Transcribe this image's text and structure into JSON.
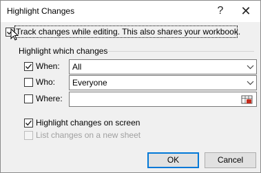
{
  "dialog": {
    "title": "Highlight Changes",
    "help_glyph": "?",
    "close_glyph": "✕"
  },
  "track": {
    "label": "Track changes while editing. This also shares your workbook.",
    "checked": true
  },
  "highlight_group": {
    "label": "Highlight which changes"
  },
  "when": {
    "label": "When:",
    "checked": true,
    "value": "All"
  },
  "who": {
    "label": "Who:",
    "checked": false,
    "value": "Everyone"
  },
  "where": {
    "label": "Where:",
    "checked": false,
    "value": ""
  },
  "on_screen": {
    "label": "Highlight changes on screen",
    "checked": true
  },
  "new_sheet": {
    "label": "List changes on a new sheet",
    "checked": false,
    "disabled": true
  },
  "buttons": {
    "ok": "OK",
    "cancel": "Cancel"
  },
  "colors": {
    "accent": "#0078d7",
    "dialog_bg": "#f0f0f0",
    "disabled_text": "#a0a0a0"
  },
  "icons": [
    "question-icon",
    "close-icon",
    "checkmark-icon",
    "dropdown-arrow-icon",
    "range-picker-icon",
    "mouse-cursor-icon"
  ]
}
